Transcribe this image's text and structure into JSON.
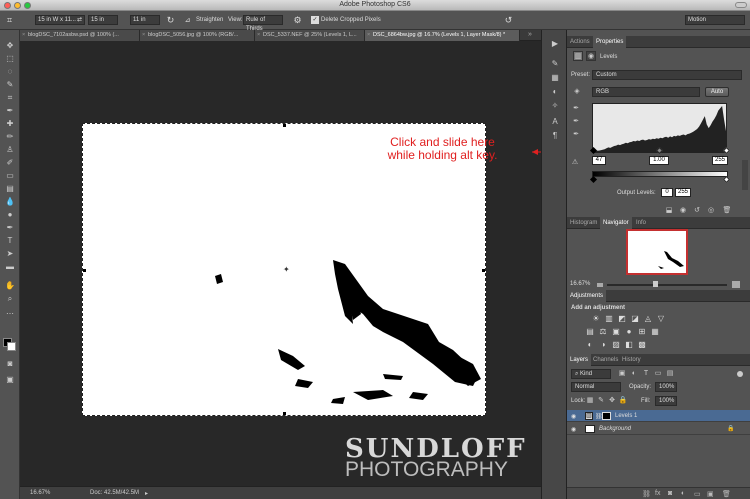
{
  "app": {
    "title": "Adobe Photoshop CS6",
    "workspace": "Motion"
  },
  "options_bar": {
    "ratio_preset": "15 in W x 11...",
    "width": "15 in",
    "height": "11 in",
    "straighten_label": "Straighten",
    "view_label": "View:",
    "view_value": "Rule of Thirds",
    "delete_cropped_label": "Delete Cropped Pixels"
  },
  "tabs": [
    {
      "label": "blogDSC_7102asbw.psd @ 100% (..."
    },
    {
      "label": "blogDSC_5056.jpg @ 100% (RGB/..."
    },
    {
      "label": "DSC_5337.NEF @ 25% (Levels 1, L..."
    },
    {
      "label": "DSC_6864bw.jpg @ 16.7% (Levels 1, Layer Mask/8) *"
    }
  ],
  "annotation": {
    "line1": "Click and slide here",
    "line2": "while holding alt key."
  },
  "watermark": {
    "line1": "SUNDLOFF",
    "line2": "PHOTOGRAPHY"
  },
  "status": {
    "zoom": "16.67%",
    "doc": "Doc: 42.5M/42.5M"
  },
  "properties_panel": {
    "tab_actions": "Actions",
    "tab_properties": "Properties",
    "title": "Levels",
    "preset_label": "Preset:",
    "preset_value": "Custom",
    "channel_value": "RGB",
    "auto_label": "Auto",
    "input_black": "47",
    "input_mid": "1.00",
    "input_white": "255",
    "output_label": "Output Levels:",
    "output_black": "0",
    "output_white": "255",
    "histogram": [
      2,
      2,
      3,
      3,
      4,
      5,
      6,
      8,
      10,
      9,
      11,
      13,
      14,
      16,
      15,
      17,
      18,
      20,
      19,
      21,
      22,
      24,
      23,
      25,
      24,
      26,
      27,
      25,
      26,
      28,
      27,
      29,
      28,
      30,
      29,
      31,
      30,
      32,
      33,
      31,
      34,
      32,
      35,
      34,
      36,
      35,
      37,
      38,
      36,
      39,
      40,
      42,
      44,
      47,
      50,
      55,
      62,
      70,
      78,
      60,
      52,
      58,
      66,
      72,
      80,
      90,
      95,
      100,
      70,
      45
    ]
  },
  "navigator_panel": {
    "tab_histogram": "Histogram",
    "tab_navigator": "Navigator",
    "tab_info": "Info",
    "zoom": "16.67%"
  },
  "adjustments_panel": {
    "title": "Adjustments",
    "add_label": "Add an adjustment",
    "row1": [
      "☀",
      "▥",
      "◩",
      "◪",
      "◬",
      "▽"
    ],
    "row2": [
      "▤",
      "⚖",
      "▣",
      "●",
      "⊞",
      "▦"
    ],
    "row3": [
      "◐",
      "◑",
      "▨",
      "◧",
      "▩"
    ]
  },
  "layers_panel": {
    "tab_layers": "Layers",
    "tab_channels": "Channels",
    "tab_history": "History",
    "kind_label": "Kind",
    "blend_mode": "Normal",
    "opacity_label": "Opacity:",
    "opacity_value": "100%",
    "lock_label": "Lock:",
    "fill_label": "Fill:",
    "fill_value": "100%",
    "layers": [
      {
        "name": "Levels 1",
        "selected": true
      },
      {
        "name": "Background",
        "selected": false
      }
    ]
  },
  "colors": {
    "accent_red": "#e02020",
    "selected_layer": "#4a6a93"
  }
}
